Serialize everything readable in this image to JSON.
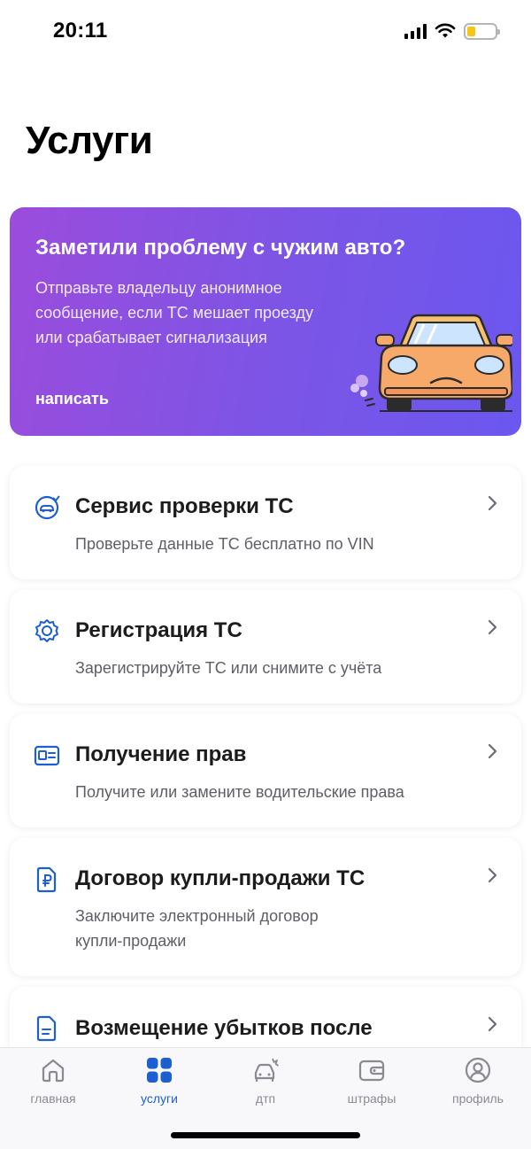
{
  "status": {
    "time": "20:11"
  },
  "page": {
    "title": "Услуги"
  },
  "promo": {
    "title": "Заметили проблему с чужим авто?",
    "text": "Отправьте владельцу анонимное сообщение, если ТС мешает проезду или срабатывает сигнализация",
    "link": "написать"
  },
  "services": [
    {
      "title": "Сервис проверки ТС",
      "subtitle": "Проверьте данные ТС бесплатно по VIN",
      "icon": "car-check-icon"
    },
    {
      "title": "Регистрация ТС",
      "subtitle": "Зарегистрируйте ТС или снимите с учёта",
      "icon": "badge-icon"
    },
    {
      "title": "Получение прав",
      "subtitle": "Получите или замените водительские права",
      "icon": "id-card-icon"
    },
    {
      "title": "Договор купли-продажи ТС",
      "subtitle": "Заключите электронный договор купли-продажи",
      "icon": "ruble-document-icon"
    },
    {
      "title": "Возмещение убытков после",
      "subtitle": "",
      "icon": "document-icon"
    }
  ],
  "tabs": [
    {
      "label": "главная",
      "icon": "home-icon",
      "active": false
    },
    {
      "label": "услуги",
      "icon": "grid-icon",
      "active": true
    },
    {
      "label": "дтп",
      "icon": "car-crash-icon",
      "active": false
    },
    {
      "label": "штрафы",
      "icon": "wallet-icon",
      "active": false
    },
    {
      "label": "профиль",
      "icon": "user-icon",
      "active": false
    }
  ],
  "colors": {
    "accent": "#1d5fd1",
    "promo_gradient_start": "#9b4cdc",
    "promo_gradient_end": "#6b57ef",
    "tab_inactive": "#8a8a93"
  }
}
